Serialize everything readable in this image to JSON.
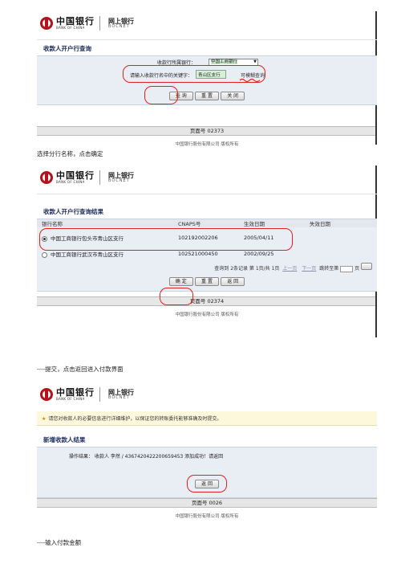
{
  "brand": {
    "bank_cn": "中国银行",
    "bank_en": "BANK OF CHINA",
    "bocnet_cn": "网上银行",
    "bocnet_en": "BOCNET"
  },
  "shot1": {
    "title": "收款人开户行查询",
    "bank_label": "收款行所属银行：",
    "bank_value": "中国工商银行",
    "keyword_label": "请输入收款行名中的关键字：",
    "keyword_value": "青山区支行",
    "fuzzy_link": "可模糊查询",
    "buttons": [
      "查 询",
      "重 置",
      "关 闭"
    ],
    "page_no": "页面号 02373",
    "copyright": "中国银行股份有限公司 版权所有"
  },
  "caption1": "选择分行名称，点击确定",
  "shot2": {
    "title": "收款人开户行查询结果",
    "columns": [
      "银行名称",
      "CNAPS号",
      "生效日期",
      "失效日期"
    ],
    "rows": [
      {
        "name": "中国工商银行包头市青山区支行",
        "cnaps": "102192002206",
        "date": "2005/04/11",
        "expire": ""
      },
      {
        "name": "中国工商银行武汉市青山区支行",
        "cnaps": "102521000450",
        "date": "2002/09/25",
        "expire": ""
      }
    ],
    "pager": {
      "summary": "查询到 2条记录  第 1页/共 1页",
      "links": [
        "上一页",
        "下一页"
      ],
      "jump_label": "跳转至第",
      "page_suffix": "页"
    },
    "buttons": [
      "确 定",
      "重 置",
      "返 回"
    ],
    "page_no": "页面号 02374",
    "copyright": "中国银行股份有限公司 版权所有"
  },
  "caption2": "----提交，点击返回进入付款界面",
  "shot3": {
    "notice": "请您对收款人的必要信息进行详细维护，以保证您的转账委托能够准确及时提交。",
    "title": "新增收款人结果",
    "result_label": "操作结果：",
    "result_text": "收款人 李然 / 4367420422200659453 添加成功！请返回",
    "button": "返 回",
    "page_no": "页面号 0026",
    "copyright": "中国银行股份有限公司 版权所有"
  },
  "caption3": "----输入付款金额",
  "colors": {
    "brand_red": "#b5121b",
    "annotation_red": "#e0221c",
    "navy_title": "#1b2c5a"
  }
}
